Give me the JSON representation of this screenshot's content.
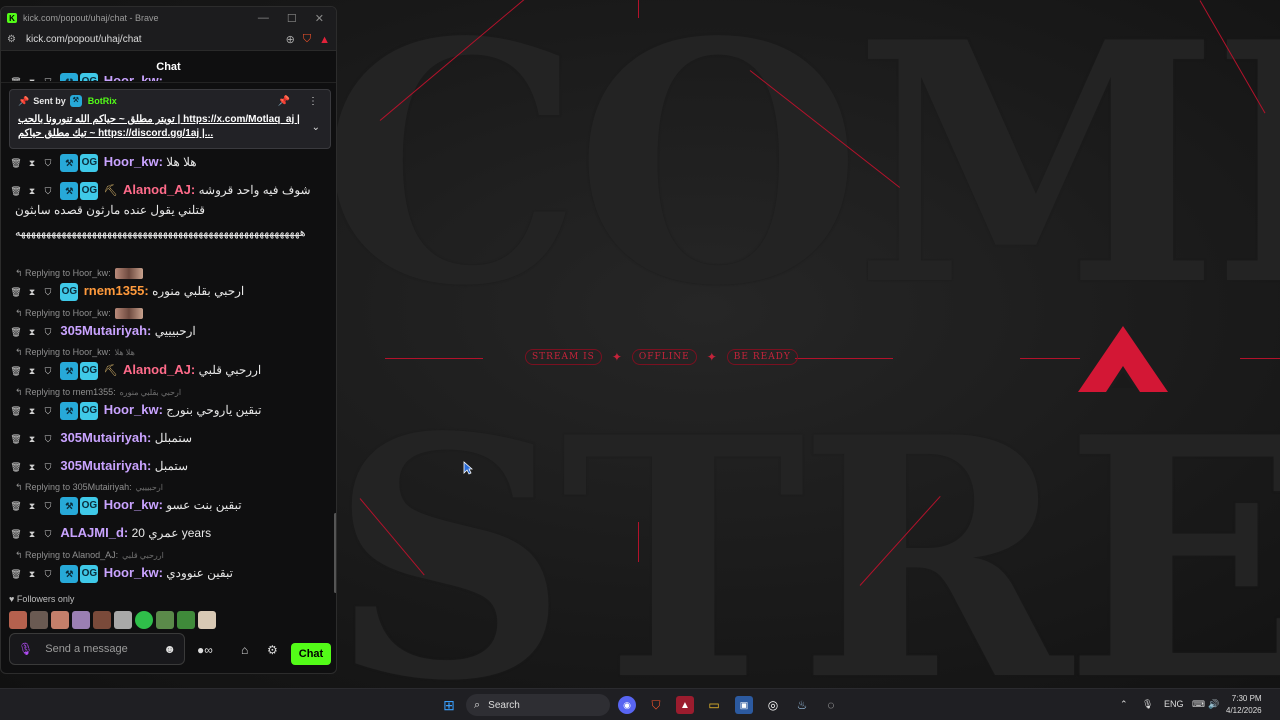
{
  "browser": {
    "window_title": "kick.com/popout/uhaj/chat - Brave",
    "url": "kick.com/popout/uhaj/chat"
  },
  "chat": {
    "header": "Chat",
    "top_partial_user": "Hoor_kw:",
    "pinned": {
      "sent_by": "Sent by",
      "bot_name": "BotRix",
      "line1": "تويتر مطلق ~ حياكم الله تنورونا بالحب | https://x.com/Motlaq_aj |",
      "line2": "تيك مطلق حياكم ~ https://discord.gg/1aj |..."
    },
    "messages": [
      {
        "user": "Hoor_kw",
        "text": "هلا هلا",
        "color": "#c9a3ff"
      },
      {
        "user": "Alanod_AJ",
        "text": "شوف فيه واحد قروشه",
        "text2": "قتلني يقول عنده مارثون قصده سابثون",
        "text3": "ههههههههههههههههههههههههههههههههههههههههههههههههههههههههه",
        "color": "#ff6b8a"
      },
      {
        "user": "rnem1355",
        "text": "ارحبي بقلبي منوره",
        "color": "#ff9a3c"
      },
      {
        "user": "305Mutairiyah",
        "text": "ارحبيييي",
        "color": "#c9a3ff"
      },
      {
        "user": "Alanod_AJ",
        "text": "اررحبي قلبي",
        "color": "#ff6b8a"
      },
      {
        "user": "Hoor_kw",
        "text": "تبقين ياروحي بنورج",
        "color": "#c9a3ff"
      },
      {
        "user": "305Mutairiyah",
        "text": "ستمبلل",
        "color": "#c9a3ff"
      },
      {
        "user": "305Mutairiyah",
        "text": "ستمبل",
        "color": "#c9a3ff"
      },
      {
        "user": "Hoor_kw",
        "text": "تبقين بنت عسو",
        "color": "#c9a3ff"
      },
      {
        "user": "ALAJMI_d",
        "text": "عمري 20 years",
        "color": "#c9a3ff"
      },
      {
        "user": "Hoor_kw",
        "text": "تبقين عنوودي",
        "color": "#c9a3ff"
      }
    ],
    "replies": [
      {
        "label": "Replying to Hoor_kw:",
        "snippet": ""
      },
      {
        "label": "Replying to Hoor_kw:",
        "snippet": ""
      },
      {
        "label": "Replying to Hoor_kw:",
        "snippet": "هلا هلا"
      },
      {
        "label": "Replying to rnem1355:",
        "snippet": "ارحبي بقلبي منوره"
      },
      {
        "label": "Replying to 305Mutairiyah:",
        "snippet": "ارحبيييي"
      },
      {
        "label": "Replying to Alanod_AJ:",
        "snippet": "اررحبي قلبي"
      }
    ],
    "followers_only": "Followers only",
    "composer_placeholder": "Send a message",
    "chat_button": "Chat"
  },
  "stream_art": {
    "big_top": "COME",
    "big_bottom": "STREA",
    "pill1": "STREAM IS",
    "pill2": "OFFLINE",
    "pill3": "BE READY"
  },
  "taskbar": {
    "search_label": "Search",
    "lang": "ENG",
    "time": "7:30 PM",
    "date": "4/12/2026"
  },
  "colors": {
    "kick_green": "#53fc18",
    "accent_red": "#c4233a"
  }
}
